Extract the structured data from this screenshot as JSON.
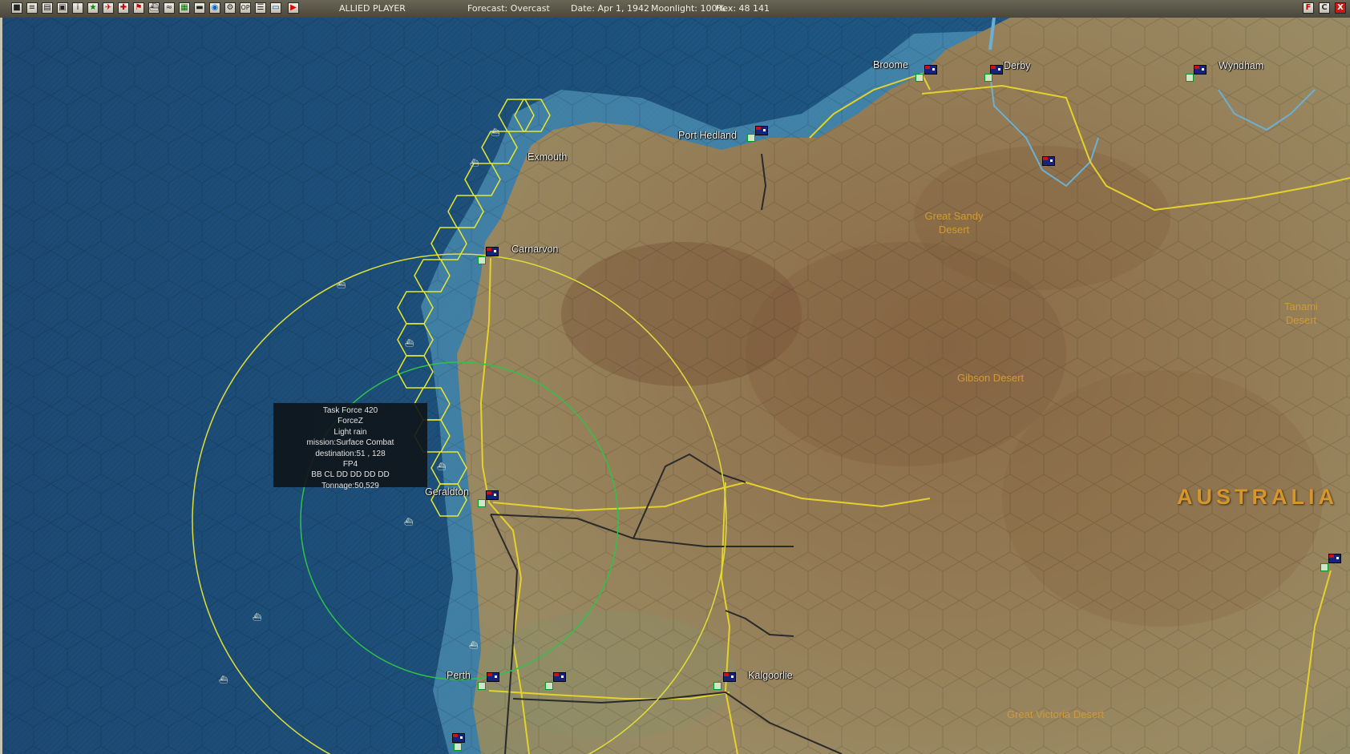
{
  "toolbar": {
    "icons": [
      "save-icon",
      "report-icon",
      "list-icon",
      "print-icon",
      "info-icon",
      "star-icon",
      "aircraft-icon",
      "ground-unit-icon",
      "flag-icon",
      "ship-icon",
      "tank-icon",
      "map-icon",
      "globe-icon",
      "settings-icon",
      "op-icon",
      "notes-icon",
      "screen-icon",
      "end-turn-icon"
    ],
    "player": "ALLIED PLAYER",
    "forecast": "Forecast: Overcast",
    "date": "Date: Apr 1, 1942",
    "moonlight": "Moonlight: 100%",
    "hex": "Hex: 48 141",
    "right_buttons": [
      "F",
      "C",
      "X"
    ]
  },
  "colors": {
    "ocean": "#1c4e78",
    "land": "#8c7552",
    "road": "#e7d02a",
    "rail": "#2a2a2a",
    "range_yellow": "#d8d83a",
    "range_green": "#2fc24a"
  },
  "map": {
    "cities": [
      "Broome",
      "Derby",
      "Wyndham",
      "Port Hedland",
      "Exmouth",
      "Carnarvon",
      "Geraldton",
      "Perth",
      "Kalgoorlie"
    ],
    "regions": [
      "Great Sandy\nDesert",
      "Gibson Desert",
      "Great Victoria Desert",
      "Tanami\nDesert"
    ],
    "country": "AUSTRALIA"
  },
  "task_force": {
    "title": "Task Force 420",
    "name": "ForceZ",
    "weather": "Light rain",
    "mission": "mission:Surface Combat",
    "destination": "destination:51 , 128",
    "fp": "FP4",
    "ships": "BB CL DD DD DD DD",
    "tonnage": "Tonnage:50,529"
  }
}
